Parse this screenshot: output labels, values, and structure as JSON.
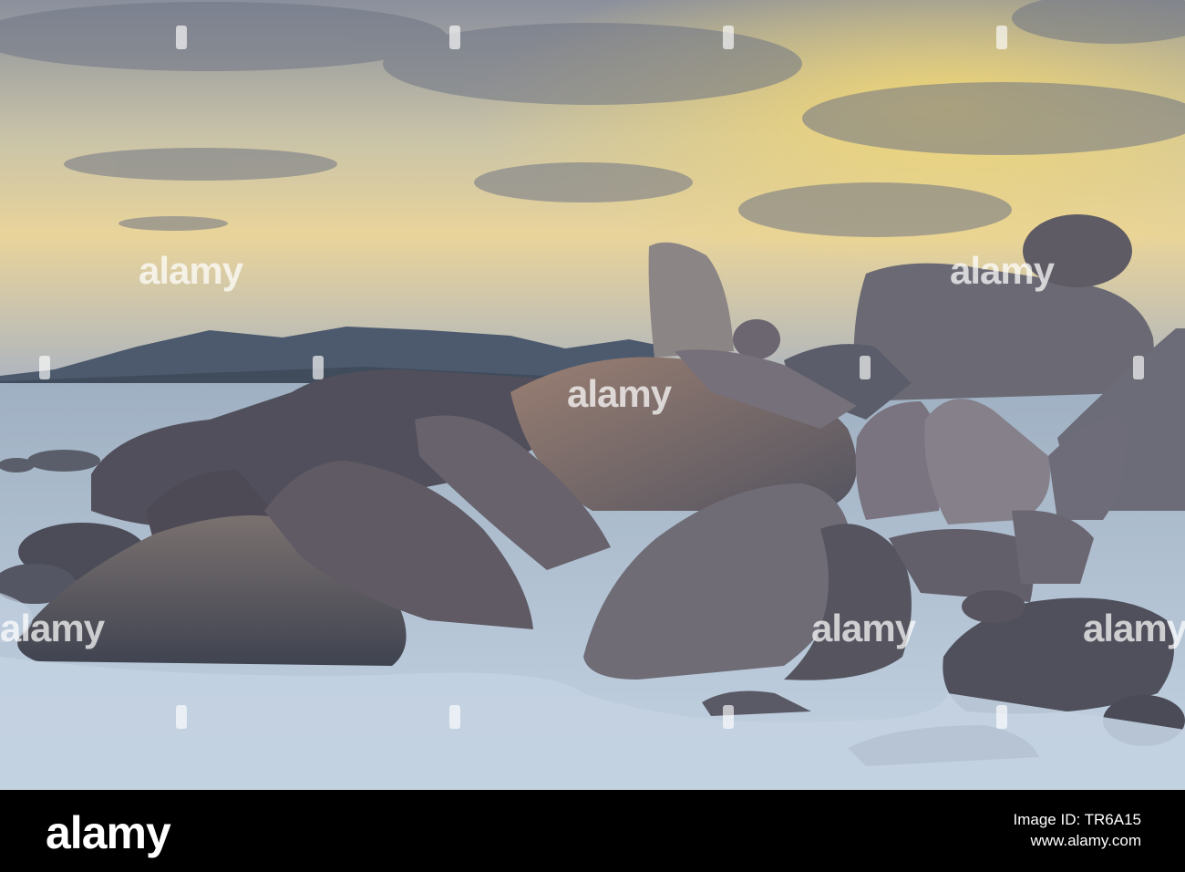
{
  "photo": {
    "description_colors": {
      "sky_top": "#8a8f9c",
      "sky_glow": "#f1d27a",
      "sea": "#b9cadb",
      "rock": "#5d5e68"
    }
  },
  "watermark": {
    "text": "alamy"
  },
  "footer": {
    "logo": "alamy",
    "line1": "Image ID: TR6A15",
    "line2": "www.alamy.com"
  }
}
